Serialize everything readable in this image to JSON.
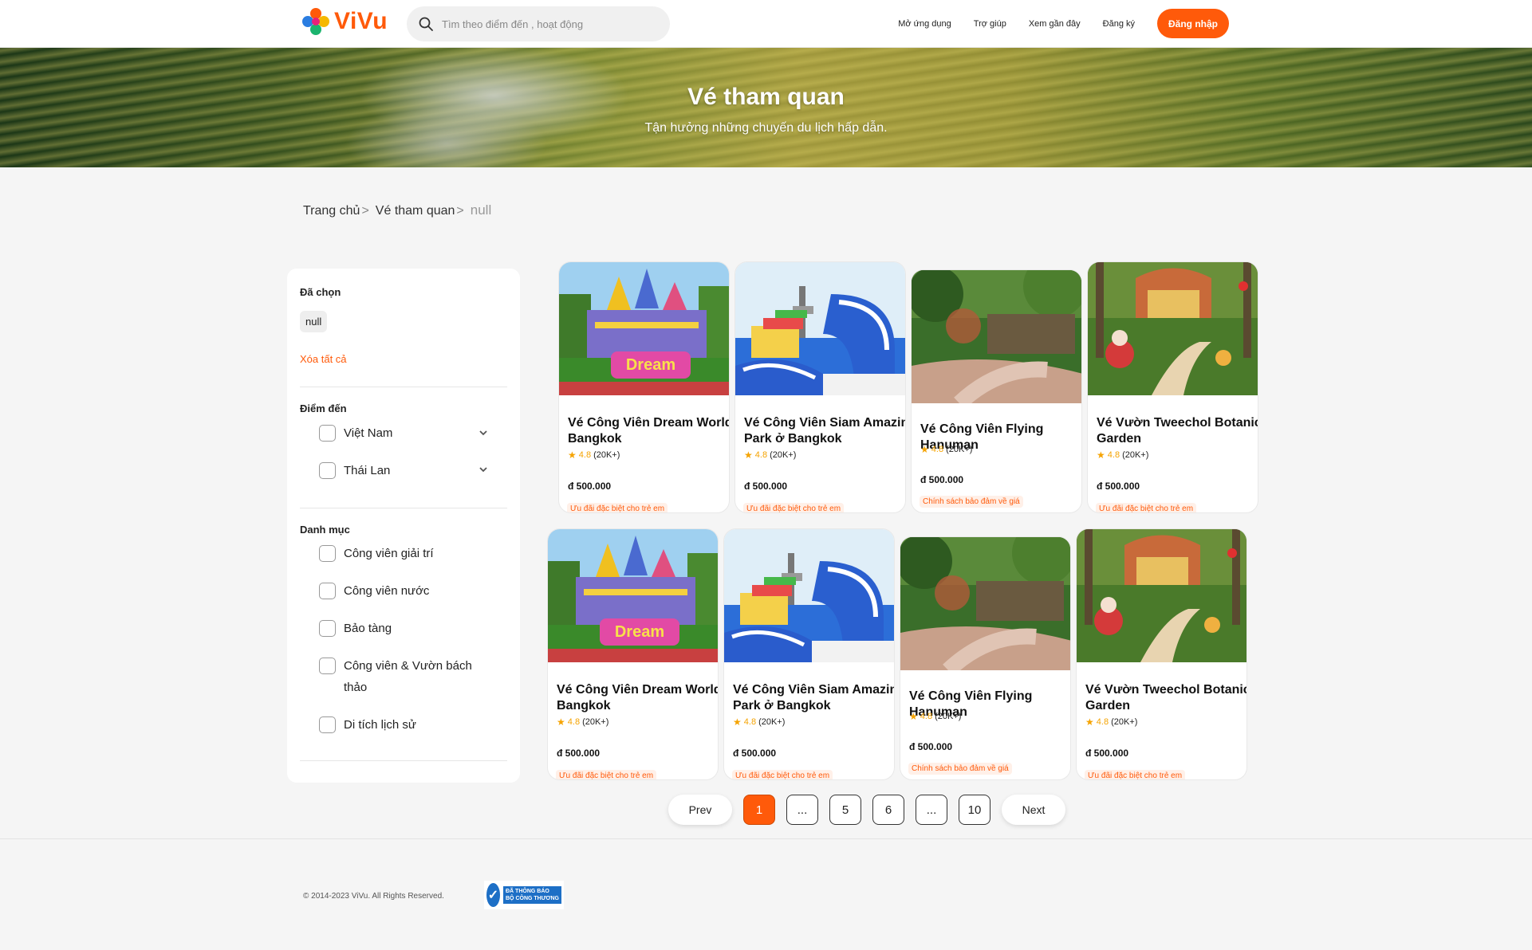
{
  "header": {
    "brand": "ViVu",
    "search_placeholder": "Tìm theo điểm đến , hoạt động",
    "nav": [
      "Mở ứng dụng",
      "Trợ giúp",
      "Xem gần đây",
      "Đăng ký"
    ],
    "login_label": "Đăng nhập",
    "accent_color": "#ff5a0a"
  },
  "hero": {
    "title": "Vé tham quan",
    "subtitle": "Tận hưởng những chuyến du lịch hấp dẫn."
  },
  "breadcrumb": {
    "home": "Trang chủ",
    "sep": ">",
    "category": "Vé tham quan",
    "current": "null"
  },
  "sidebar": {
    "selected_title": "Đã chọn",
    "selected_chip": "null",
    "clear_all": "Xóa tất cả",
    "destination_title": "Điểm đến",
    "destinations": [
      "Việt Nam",
      "Thái Lan"
    ],
    "category_title": "Danh mục",
    "categories": [
      "Công viên giải trí",
      "Công viên nước",
      "Bảo tàng",
      "Công viên & Vườn bách thảo",
      "Di tích lịch sử"
    ]
  },
  "cards": [
    {
      "title": "Vé Công Viên Dream World Bangkok",
      "rating": "4.8",
      "reviews": "(20K+)",
      "price": "đ 500.000",
      "promo": "Ưu đãi đặc biệt cho trẻ em",
      "image": "dreamworld"
    },
    {
      "title": "Vé Công Viên Siam Amazing Park ở Bangkok",
      "rating": "4.8",
      "reviews": "(20K+)",
      "price": "đ 500.000",
      "promo": "Ưu đãi đặc biệt cho trẻ em",
      "image": "waterpark"
    },
    {
      "title": "Vé Công Viên Flying Hanuman",
      "rating": "4.8",
      "reviews": "(20K+)",
      "price": "đ 500.000",
      "promo": "Chính sách bảo đảm về giá",
      "image": "jungle"
    },
    {
      "title": "Vé Vườn Tweechol Botanic Garden",
      "rating": "4.8",
      "reviews": "(20K+)",
      "price": "đ 500.000",
      "promo": "Ưu đãi đặc biệt cho trẻ em",
      "image": "garden"
    },
    {
      "title": "Vé Công Viên Dream World Bangkok",
      "rating": "4.8",
      "reviews": "(20K+)",
      "price": "đ 500.000",
      "promo": "Ưu đãi đặc biệt cho trẻ em",
      "image": "dreamworld"
    },
    {
      "title": "Vé Công Viên Siam Amazing Park ở Bangkok",
      "rating": "4.8",
      "reviews": "(20K+)",
      "price": "đ 500.000",
      "promo": "Ưu đãi đặc biệt cho trẻ em",
      "image": "waterpark"
    },
    {
      "title": "Vé Công Viên Flying Hanuman",
      "rating": "4.8",
      "reviews": "(20K+)",
      "price": "đ 500.000",
      "promo": "Chính sách bảo đảm về giá",
      "image": "jungle"
    },
    {
      "title": "Vé Vườn Tweechol Botanic Garden",
      "rating": "4.8",
      "reviews": "(20K+)",
      "price": "đ 500.000",
      "promo": "Ưu đãi đặc biệt cho trẻ em",
      "image": "garden"
    }
  ],
  "pagination": {
    "prev": "Prev",
    "next": "Next",
    "pages": [
      "1",
      "...",
      "5",
      "6",
      "...",
      "10"
    ],
    "current": "1"
  },
  "footer": {
    "copyright": "© 2014-2023 ViVu. All Rights Reserved.",
    "badge_line1": "ĐÃ THÔNG BÁO",
    "badge_line2": "BỘ CÔNG THƯƠNG"
  }
}
